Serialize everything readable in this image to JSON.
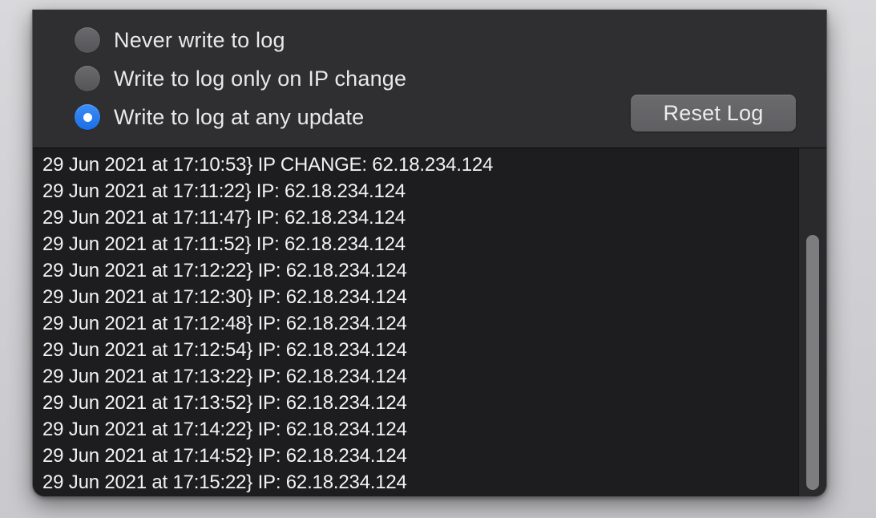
{
  "log_options": {
    "items": [
      {
        "label": "Never write to log",
        "selected": false
      },
      {
        "label": "Write to log only on IP change",
        "selected": false
      },
      {
        "label": "Write to log at any update",
        "selected": true
      }
    ]
  },
  "toolbar": {
    "reset_label": "Reset Log"
  },
  "log": {
    "lines": [
      "29 Jun 2021 at 17:10:53} IP CHANGE: 62.18.234.124",
      "29 Jun 2021 at 17:11:22} IP: 62.18.234.124",
      "29 Jun 2021 at 17:11:47} IP: 62.18.234.124",
      "29 Jun 2021 at 17:11:52} IP: 62.18.234.124",
      "29 Jun 2021 at 17:12:22} IP: 62.18.234.124",
      "29 Jun 2021 at 17:12:30} IP: 62.18.234.124",
      "29 Jun 2021 at 17:12:48} IP: 62.18.234.124",
      "29 Jun 2021 at 17:12:54} IP: 62.18.234.124",
      "29 Jun 2021 at 17:13:22} IP: 62.18.234.124",
      "29 Jun 2021 at 17:13:52} IP: 62.18.234.124",
      "29 Jun 2021 at 17:14:22} IP: 62.18.234.124",
      "29 Jun 2021 at 17:14:52} IP: 62.18.234.124",
      "29 Jun 2021 at 17:15:22} IP: 62.18.234.124"
    ]
  },
  "colors": {
    "accent": "#1c6fe6",
    "panel_bg": "#2f2f31",
    "log_bg": "#1d1d1f",
    "button_bg": "#626265"
  }
}
